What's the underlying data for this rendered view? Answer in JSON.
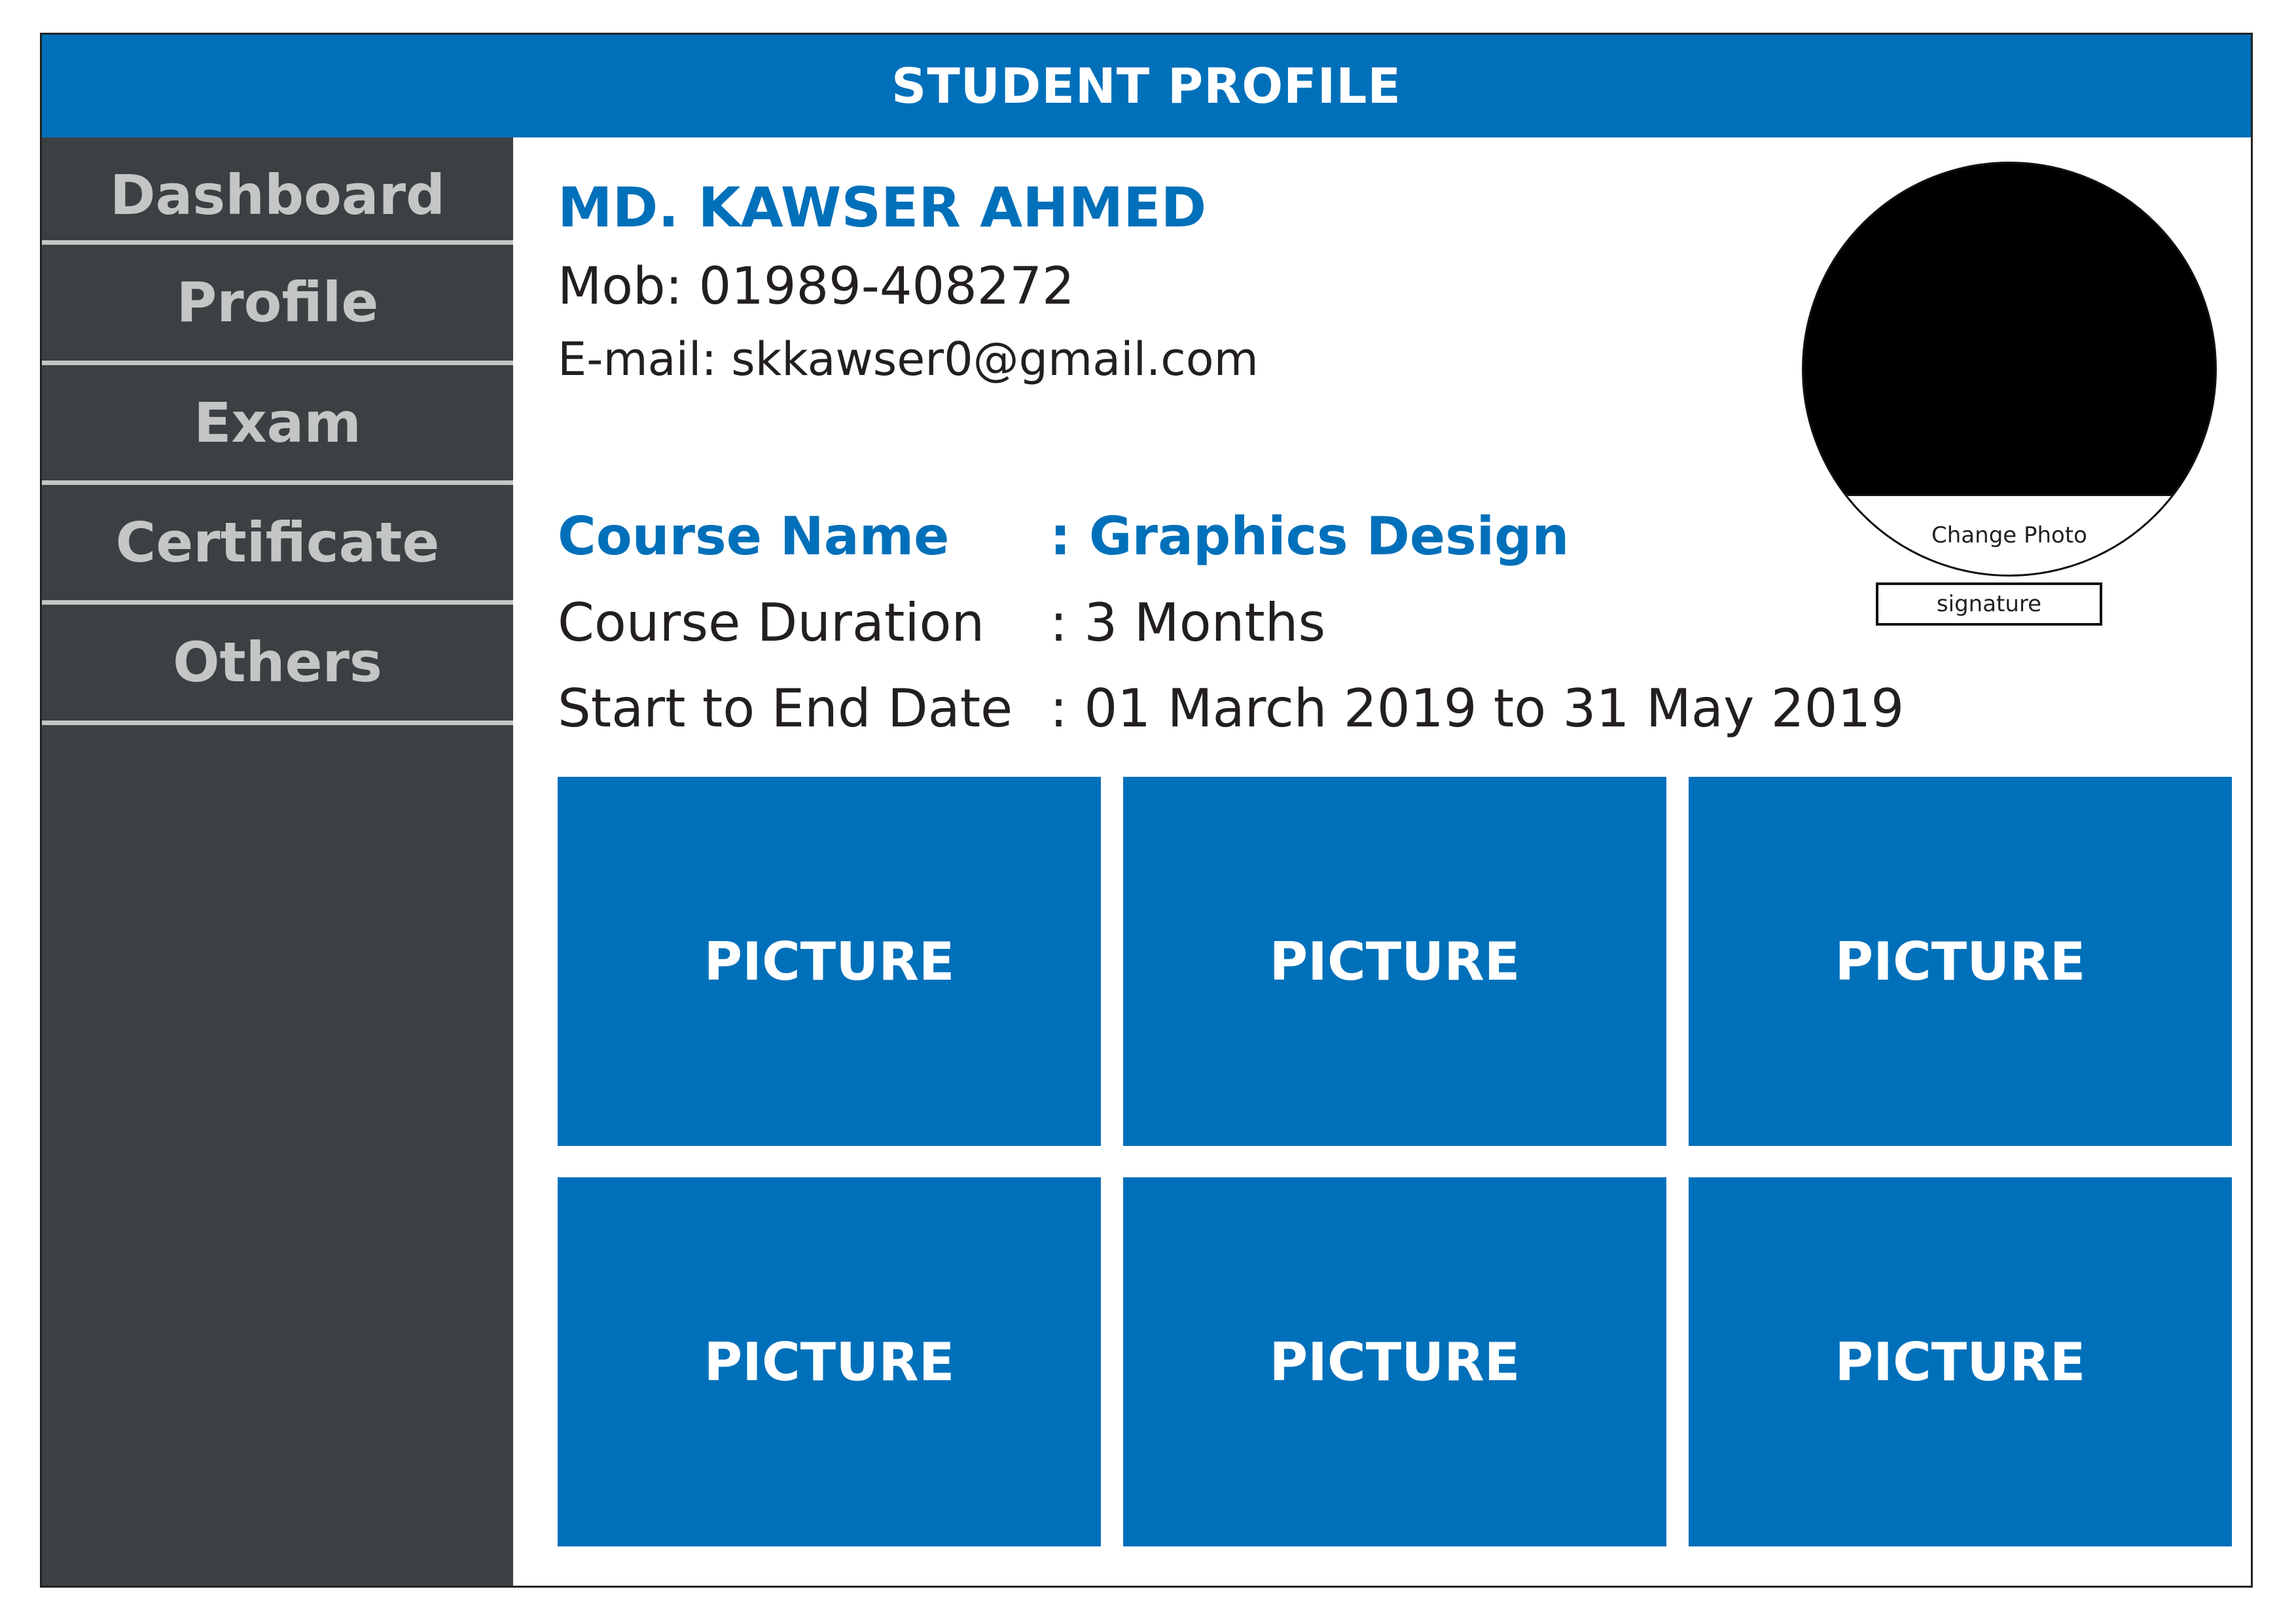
{
  "header": {
    "title": "STUDENT PROFILE"
  },
  "sidebar": {
    "items": [
      {
        "label": "Dashboard"
      },
      {
        "label": "Profile"
      },
      {
        "label": "Exam"
      },
      {
        "label": "Certificate"
      },
      {
        "label": "Others"
      }
    ]
  },
  "student": {
    "name": "MD. KAWSER AHMED",
    "mobile": "Mob: 01989-408272",
    "email": "E-mail: skkawser0@gmail.com"
  },
  "course": {
    "rows": [
      {
        "label": "Course Name",
        "value": ": Graphics Design"
      },
      {
        "label": "Course Duration",
        "value": ": 3 Months"
      },
      {
        "label": "Start to End Date",
        "value": ": 01 March 2019 to 31 May 2019"
      }
    ]
  },
  "photo": {
    "change_label": "Change Photo",
    "signature_label": "signature"
  },
  "gallery": {
    "tiles": [
      {
        "label": "PICTURE"
      },
      {
        "label": "PICTURE"
      },
      {
        "label": "PICTURE"
      },
      {
        "label": "PICTURE"
      },
      {
        "label": "PICTURE"
      },
      {
        "label": "PICTURE"
      }
    ]
  },
  "colors": {
    "accent": "#0070ba",
    "sidebar": "#3b4142",
    "sidebar_text": "#c4c6c6",
    "text": "#231f20"
  }
}
